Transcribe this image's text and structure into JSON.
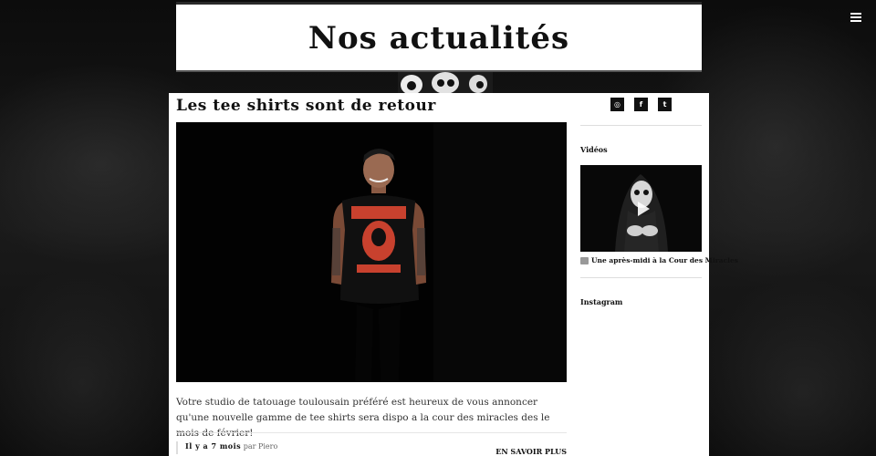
{
  "page": {
    "title": "Nos actualités"
  },
  "header": {
    "menu_icon": "hamburger-icon"
  },
  "post": {
    "title": "Les tee shirts sont de retour",
    "image_icon": "tshirt-photo",
    "excerpt": "Votre studio de tatouage toulousain préféré est heureux de vous annoncer qu'une nouvelle gamme de tee shirts sera dispo a la cour des miracles des le mois de février!",
    "date": "Il y a 7 mois",
    "author_prefix": "par",
    "author": "Piero",
    "more_label": "EN SAVOIR PLUS"
  },
  "sidebar": {
    "social": [
      {
        "icon": "instagram-icon",
        "glyph": "◎"
      },
      {
        "icon": "facebook-icon",
        "glyph": "f"
      },
      {
        "icon": "twitter-icon",
        "glyph": "t"
      }
    ],
    "videos_title": "Vidéos",
    "video_caption": "Une après-midi à la Cour des Miracles",
    "video_icon": "youtube-icon",
    "instagram_title": "Instagram"
  },
  "colors": {
    "background": "#0a0a0a",
    "panel": "#ffffff",
    "text": "#111111",
    "tshirt_print": "#c8412e"
  }
}
